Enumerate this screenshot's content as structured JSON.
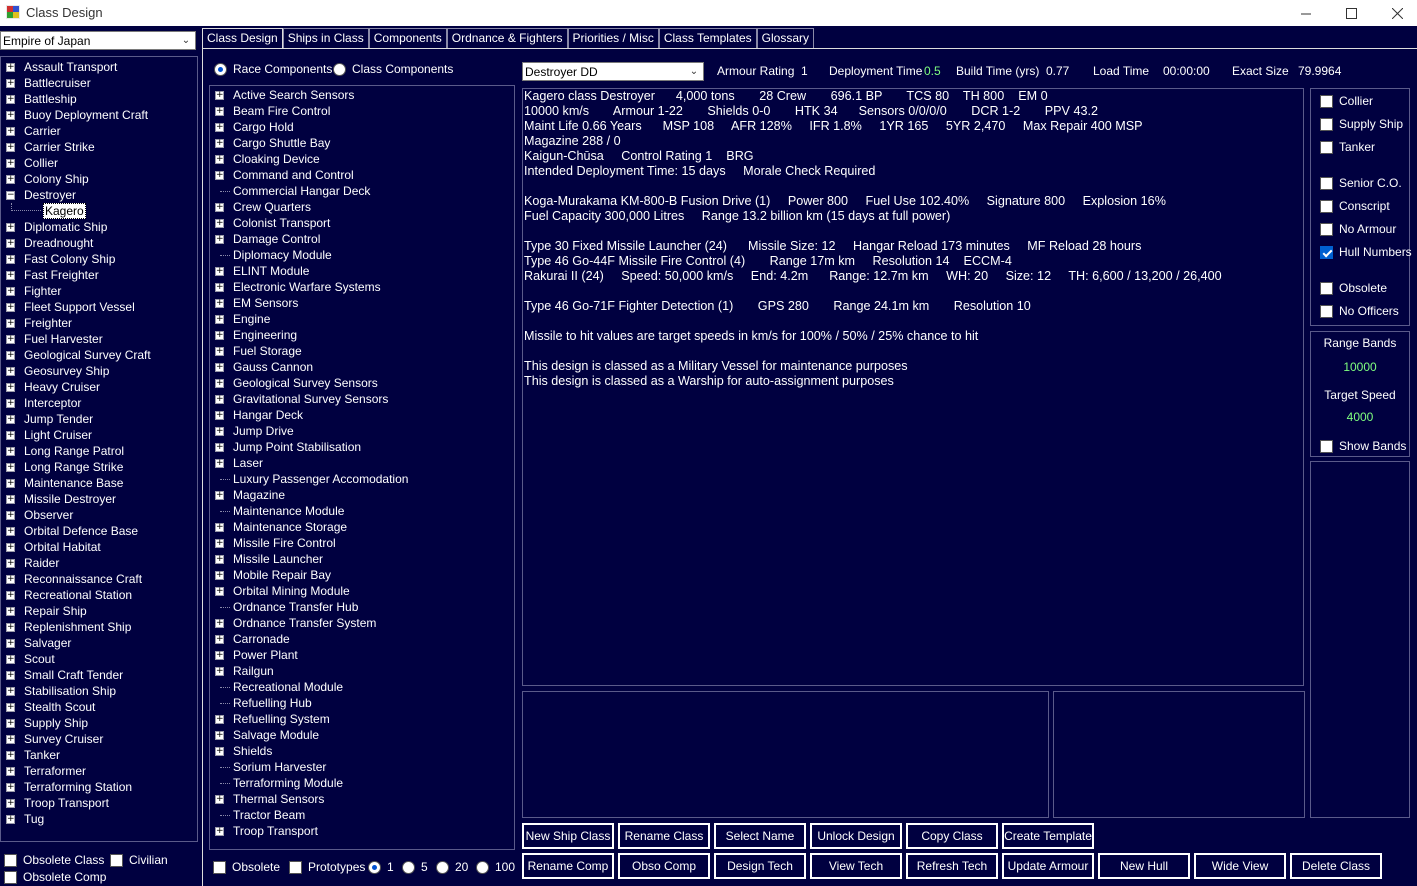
{
  "window": {
    "title": "Class Design"
  },
  "race_select": {
    "value": "Empire of Japan"
  },
  "class_types": [
    {
      "label": "Assault Transport"
    },
    {
      "label": "Battlecruiser"
    },
    {
      "label": "Battleship"
    },
    {
      "label": "Buoy Deployment Craft"
    },
    {
      "label": "Carrier"
    },
    {
      "label": "Carrier Strike"
    },
    {
      "label": "Collier"
    },
    {
      "label": "Colony Ship"
    },
    {
      "label": "Destroyer",
      "expanded": true,
      "children": [
        "Kagero"
      ]
    },
    {
      "label": "Diplomatic Ship"
    },
    {
      "label": "Dreadnought"
    },
    {
      "label": "Fast Colony Ship"
    },
    {
      "label": "Fast Freighter"
    },
    {
      "label": "Fighter"
    },
    {
      "label": "Fleet Support Vessel"
    },
    {
      "label": "Freighter"
    },
    {
      "label": "Fuel Harvester"
    },
    {
      "label": "Geological Survey Craft"
    },
    {
      "label": "Geosurvey Ship"
    },
    {
      "label": "Heavy Cruiser"
    },
    {
      "label": "Interceptor"
    },
    {
      "label": "Jump Tender"
    },
    {
      "label": "Light Cruiser"
    },
    {
      "label": "Long Range Patrol"
    },
    {
      "label": "Long Range Strike"
    },
    {
      "label": "Maintenance Base"
    },
    {
      "label": "Missile Destroyer"
    },
    {
      "label": "Observer"
    },
    {
      "label": "Orbital Defence Base"
    },
    {
      "label": "Orbital Habitat"
    },
    {
      "label": "Raider"
    },
    {
      "label": "Reconnaissance Craft"
    },
    {
      "label": "Recreational Station"
    },
    {
      "label": "Repair Ship"
    },
    {
      "label": "Replenishment Ship"
    },
    {
      "label": "Salvager"
    },
    {
      "label": "Scout"
    },
    {
      "label": "Small Craft Tender"
    },
    {
      "label": "Stabilisation Ship"
    },
    {
      "label": "Stealth Scout"
    },
    {
      "label": "Supply Ship"
    },
    {
      "label": "Survey Cruiser"
    },
    {
      "label": "Tanker"
    },
    {
      "label": "Terraformer"
    },
    {
      "label": "Terraforming Station"
    },
    {
      "label": "Troop Transport"
    },
    {
      "label": "Tug"
    }
  ],
  "left_options": {
    "obsolete_class": "Obsolete Class",
    "civilian": "Civilian",
    "obsolete_comp": "Obsolete Comp"
  },
  "tabs": [
    "Class Design",
    "Ships in Class",
    "Components",
    "Ordnance & Fighters",
    "Priorities / Misc",
    "Class Templates",
    "Glossary"
  ],
  "component_source": {
    "race": "Race Components",
    "class": "Class Components"
  },
  "components": [
    {
      "label": "Active Search Sensors",
      "exp": true
    },
    {
      "label": "Beam Fire Control",
      "exp": true
    },
    {
      "label": "Cargo Hold",
      "exp": true
    },
    {
      "label": "Cargo Shuttle Bay",
      "exp": true
    },
    {
      "label": "Cloaking Device",
      "exp": true
    },
    {
      "label": "Command and Control",
      "exp": true
    },
    {
      "label": "Commercial Hangar Deck",
      "exp": false
    },
    {
      "label": "Crew Quarters",
      "exp": true
    },
    {
      "label": "Colonist Transport",
      "exp": true
    },
    {
      "label": "Damage Control",
      "exp": true
    },
    {
      "label": "Diplomacy Module",
      "exp": false
    },
    {
      "label": "ELINT Module",
      "exp": true
    },
    {
      "label": "Electronic Warfare Systems",
      "exp": true
    },
    {
      "label": "EM Sensors",
      "exp": true
    },
    {
      "label": "Engine",
      "exp": true
    },
    {
      "label": "Engineering",
      "exp": true
    },
    {
      "label": "Fuel Storage",
      "exp": true
    },
    {
      "label": "Gauss Cannon",
      "exp": true
    },
    {
      "label": "Geological Survey Sensors",
      "exp": true
    },
    {
      "label": "Gravitational Survey Sensors",
      "exp": true
    },
    {
      "label": "Hangar Deck",
      "exp": true
    },
    {
      "label": "Jump Drive",
      "exp": true
    },
    {
      "label": "Jump Point Stabilisation",
      "exp": true
    },
    {
      "label": "Laser",
      "exp": true
    },
    {
      "label": "Luxury Passenger Accomodation",
      "exp": false
    },
    {
      "label": "Magazine",
      "exp": true
    },
    {
      "label": "Maintenance Module",
      "exp": false
    },
    {
      "label": "Maintenance Storage",
      "exp": true
    },
    {
      "label": "Missile Fire Control",
      "exp": true
    },
    {
      "label": "Missile Launcher",
      "exp": true
    },
    {
      "label": "Mobile Repair Bay",
      "exp": true
    },
    {
      "label": "Orbital Mining Module",
      "exp": true
    },
    {
      "label": "Ordnance Transfer Hub",
      "exp": false
    },
    {
      "label": "Ordnance Transfer System",
      "exp": true
    },
    {
      "label": "Carronade",
      "exp": true
    },
    {
      "label": "Power Plant",
      "exp": true
    },
    {
      "label": "Railgun",
      "exp": true
    },
    {
      "label": "Recreational Module",
      "exp": false
    },
    {
      "label": "Refuelling Hub",
      "exp": false
    },
    {
      "label": "Refuelling System",
      "exp": true
    },
    {
      "label": "Salvage Module",
      "exp": true
    },
    {
      "label": "Shields",
      "exp": true
    },
    {
      "label": "Sorium Harvester",
      "exp": false
    },
    {
      "label": "Terraforming Module",
      "exp": false
    },
    {
      "label": "Thermal Sensors",
      "exp": true
    },
    {
      "label": "Tractor Beam",
      "exp": false
    },
    {
      "label": "Troop Transport",
      "exp": true
    }
  ],
  "component_filters": {
    "obsolete": "Obsolete",
    "prototypes": "Prototypes",
    "amounts": [
      "1",
      "5",
      "20",
      "100"
    ]
  },
  "class_select": {
    "value": "Destroyer  DD"
  },
  "stats": {
    "armour_rating_label": "Armour Rating",
    "armour_rating": "1",
    "deployment_time_label": "Deployment Time",
    "deployment_time": "0.5",
    "build_time_label": "Build Time (yrs)",
    "build_time": "0.77",
    "load_time_label": "Load Time",
    "load_time": "00:00:00",
    "exact_size_label": "Exact Size",
    "exact_size": "79.9964"
  },
  "summary_lines": [
    "Kagero class Destroyer      4,000 tons       28 Crew       696.1 BP       TCS 80    TH 800    EM 0",
    "10000 km/s       Armour 1-22       Shields 0-0       HTK 34      Sensors 0/0/0/0       DCR 1-2       PPV 43.2",
    "Maint Life 0.66 Years      MSP 108     AFR 128%     IFR 1.8%     1YR 165     5YR 2,470     Max Repair 400 MSP",
    "Magazine 288 / 0",
    "Kaigun-Chūsa     Control Rating 1    BRG",
    "Intended Deployment Time: 15 days     Morale Check Required",
    "",
    "Koga-Murakama KM-800-B Fusion Drive (1)     Power 800     Fuel Use 102.40%     Signature 800     Explosion 16%",
    "Fuel Capacity 300,000 Litres     Range 13.2 billion km (15 days at full power)",
    "",
    "Type 30 Fixed Missile Launcher (24)      Missile Size: 12     Hangar Reload 173 minutes     MF Reload 28 hours",
    "Type 46 Go-44F Missile Fire Control (4)       Range 17m km     Resolution 14    ECCM-4",
    "Rakurai II (24)     Speed: 50,000 km/s     End: 4.2m      Range: 12.7m km     WH: 20     Size: 12     TH: 6,600 / 13,200 / 26,400",
    "",
    "Type 46 Go-71F Fighter Detection (1)       GPS 280       Range 24.1m km       Resolution 10",
    "",
    "Missile to hit values are target speeds in km/s for 100% / 50% / 25% chance to hit",
    "",
    "This design is classed as a Military Vessel for maintenance purposes",
    "This design is classed as a Warship for auto-assignment purposes"
  ],
  "flags": [
    {
      "label": "Collier",
      "checked": false
    },
    {
      "label": "Supply Ship",
      "checked": false
    },
    {
      "label": "Tanker",
      "checked": false
    },
    {
      "label": "Senior C.O.",
      "checked": false
    },
    {
      "label": "Conscript",
      "checked": false
    },
    {
      "label": "No Armour",
      "checked": false
    },
    {
      "label": "Hull Numbers",
      "checked": true
    },
    {
      "label": "Obsolete",
      "checked": false
    },
    {
      "label": "No Officers",
      "checked": false
    }
  ],
  "range_panel": {
    "range_bands_label": "Range Bands",
    "range_bands": "10000",
    "target_speed_label": "Target Speed",
    "target_speed": "4000",
    "show_bands": "Show Bands"
  },
  "buttons_row1": [
    "New Ship Class",
    "Rename Class",
    "Select Name",
    "Unlock Design",
    "Copy Class",
    "Create Template"
  ],
  "buttons_row2": [
    "Rename Comp",
    "Obso Comp",
    "Design Tech",
    "View Tech",
    "Refresh Tech",
    "Update Armour",
    "New Hull",
    "Wide View",
    "Delete Class"
  ],
  "colors": {
    "background": "#000040",
    "highlight": "#7fff7f",
    "border": "#5a5a8a"
  }
}
